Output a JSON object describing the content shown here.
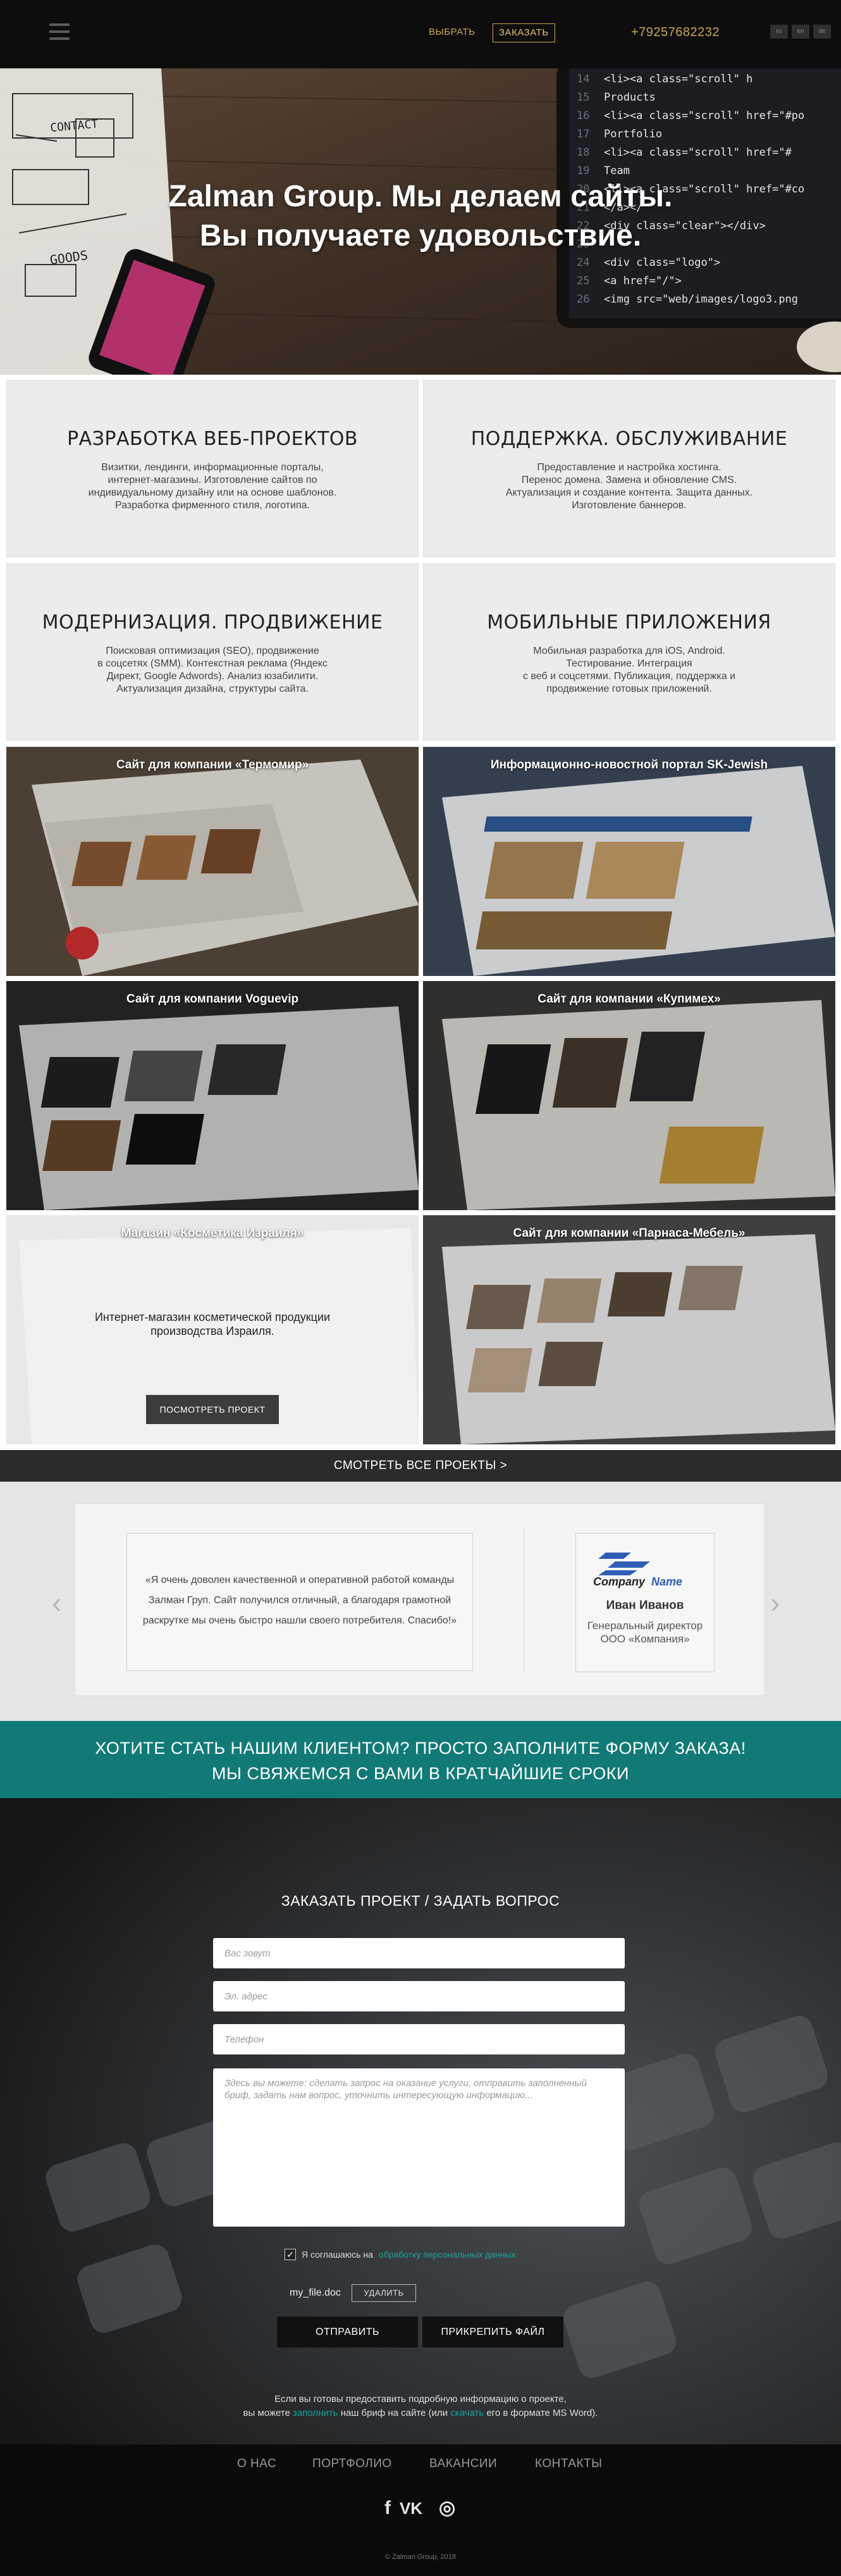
{
  "header": {
    "choose_label": "ВЫБРАТЬ",
    "order_label": "ЗАКАЗАТЬ",
    "phone": "+79257682232",
    "langs": [
      "ru",
      "en",
      "de"
    ],
    "accent_color": "#c9a84c"
  },
  "hero": {
    "title_line1": "Zalman Group. Мы делаем сайты.",
    "title_line2": "Вы получаете удовольствие.",
    "sketch_labels": [
      "CONTACT",
      "GOODS"
    ],
    "code_lines": [
      "<li><a class=\"scroll\" h",
      "Products",
      "<li><a class=\"scroll\" href=\"#po",
      "Portfolio",
      "<li><a class=\"scroll\" href=\"#",
      "Team",
      "<li><a class=\"scroll\" href=\"#co",
      "</a></",
      "<div class=\"clear\"></div>",
      "",
      "<div class=\"logo\">",
      "<a href=\"/\">",
      "<img src=\"web/images/logo3.png"
    ],
    "line_numbers": [
      "14",
      "15",
      "16",
      "17",
      "18",
      "19",
      "20",
      "21",
      "22",
      "23",
      "24",
      "25",
      "26"
    ]
  },
  "services": [
    {
      "title": "РАЗРАБОТКА ВЕБ-ПРОЕКТОВ",
      "lines": [
        "Визитки, лендинги, информационные порталы,",
        "интернет-магазины. Изготовление сайтов по",
        "индивидуальному дизайну или на основе шаблонов.",
        "Разработка фирменного стиля, логотипа."
      ]
    },
    {
      "title": "ПОДДЕРЖКА. ОБСЛУЖИВАНИЕ",
      "lines": [
        "Предоставление и настройка хостинга.",
        "Перенос домена. Замена и обновление CMS.",
        "Актуализация и создание контента. Защита данных.",
        "Изготовление баннеров."
      ]
    },
    {
      "title": "МОДЕРНИЗАЦИЯ. ПРОДВИЖЕНИЕ",
      "lines": [
        "Поисковая оптимизация (SEO), продвижение",
        "в соцсетях (SMM). Контекстная реклама (Яндекс",
        "Директ, Google Adwords). Анализ юзабилити.",
        "Актуализация дизайна, структуры сайта."
      ]
    },
    {
      "title": "МОБИЛЬНЫЕ ПРИЛОЖЕНИЯ",
      "lines": [
        "Мобильная разработка для iOS, Android.",
        "Тестирование. Интеграция",
        "с веб и соцсетями. Публикация, поддержка и",
        "продвижение готовых приложений."
      ]
    }
  ],
  "projects": [
    {
      "title": "Сайт для компании «Термомир»"
    },
    {
      "title": "Информационно-новостной портал SK-Jewish"
    },
    {
      "title": "Сайт для компании Voguevip"
    },
    {
      "title": "Сайт для компании «Купимех»"
    },
    {
      "title": "Магазин «Косметика Израиля»",
      "description_line1": "Интернет-магазин косметической продукции",
      "description_line2": "производства Израиля.",
      "button": "ПОСМОТРЕТЬ ПРОЕКТ"
    },
    {
      "title": "Сайт для компании «Парнаса-Мебель»"
    }
  ],
  "all_projects_label": "СМОТРЕТЬ ВСЕ ПРОЕКТЫ >",
  "testimonial": {
    "line1": "«Я очень доволен качественной и оперативной работой команды",
    "line2": "Залман Груп. Сайт получился отличный, а благодаря грамотной",
    "line3": "раскрутке мы очень быстро нашли своего потребителя. Спасибо!»",
    "logo_company": "Company",
    "logo_name": "Name",
    "author_name": "Иван Иванов",
    "author_position_line1": "Генеральный директор",
    "author_position_line2": "ООО «Компания»",
    "prev_icon": "‹",
    "next_icon": "›"
  },
  "cta": {
    "line1": "ХОТИТЕ СТАТЬ НАШИМ КЛИЕНТОМ? ПРОСТО ЗАПОЛНИТЕ ФОРМУ ЗАКАЗА!",
    "line2": "МЫ СВЯЖЕМСЯ С ВАМИ В КРАТЧАЙШИЕ СРОКИ",
    "color": "#127a76"
  },
  "form": {
    "title": "ЗАКАЗАТЬ ПРОЕКТ / ЗАДАТЬ ВОПРОС",
    "name_placeholder": "Вас зовут",
    "email_placeholder": "Эл. адрес",
    "phone_placeholder": "Телефон",
    "message_placeholder": "Здесь вы можете: сделать запрос на оказание услуги, отправить заполненный бриф, задать нам вопрос, уточнить интересующую информацию...",
    "agree_prefix": "Я соглашаюсь на",
    "agree_link": "обработку персональных данных",
    "check_mark": "✓",
    "file_name": "my_file.doc",
    "delete_label": "УДАЛИТЬ",
    "send_label": "ОТПРАВИТЬ",
    "attach_label": "ПРИКРЕПИТЬ ФАЙЛ",
    "note_line1": "Если вы готовы предоставить подробную информацию о проекте,",
    "note_line2_a": "вы можете",
    "note_line2_link1": "заполнить",
    "note_line2_b": "наш бриф на сайте (или",
    "note_line2_link2": "скачать",
    "note_line2_c": "его в формате MS Word)."
  },
  "footer": {
    "nav": [
      "О НАС",
      "ПОРТФОЛИО",
      "ВАКАНСИИ",
      "КОНТАКТЫ"
    ],
    "social": [
      "f",
      "VK",
      "◎"
    ],
    "copyright": "© Zalman Group, 2018"
  }
}
